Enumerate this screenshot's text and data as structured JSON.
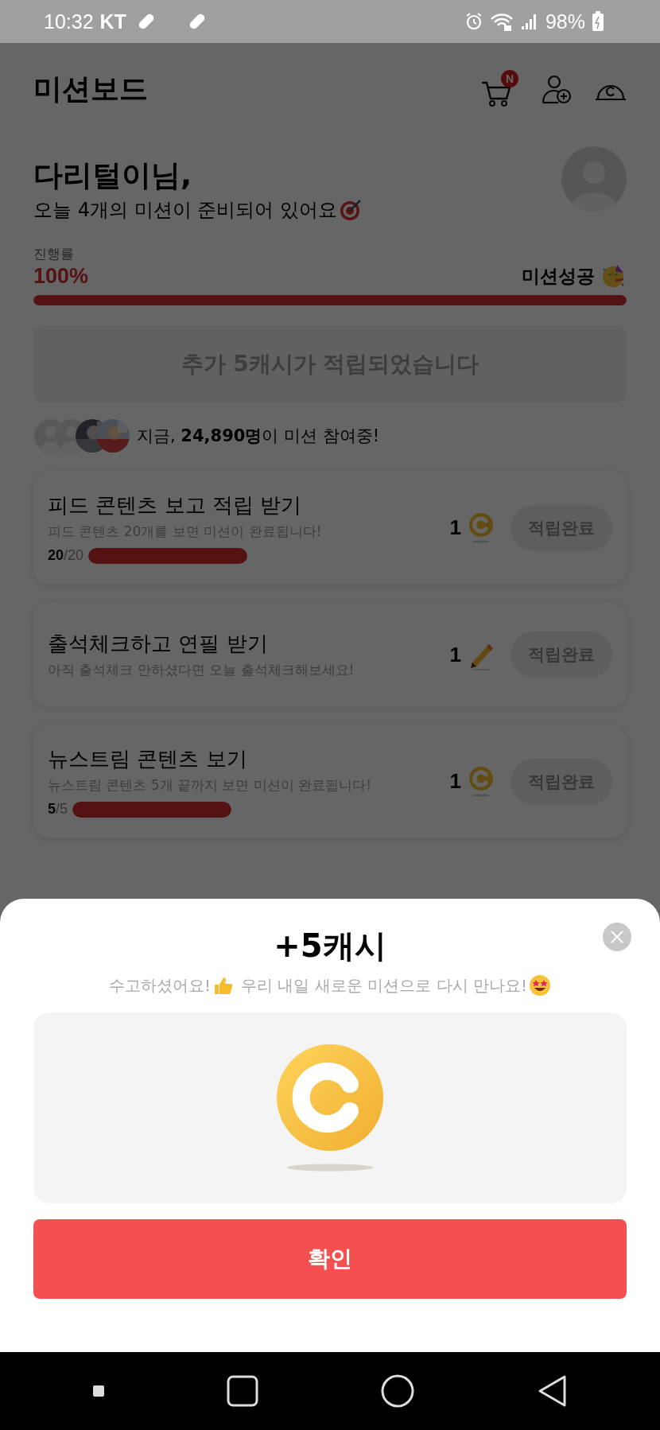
{
  "status_bar": {
    "time": "10:32",
    "carrier": "KT",
    "battery": "98%"
  },
  "header": {
    "title": "미션보드",
    "cart_badge": "N"
  },
  "greeting": {
    "name": "다리털이님,",
    "message": "오늘 4개의 미션이 준비되어 있어요"
  },
  "progress": {
    "label": "진행률",
    "percent": "100%",
    "level": 1,
    "status": "미션성공"
  },
  "bonus_banner": "추가 5캐시가 적립되었습니다",
  "participants": {
    "text": "지금, **24,890명**이 미션 참여중!",
    "avatars": [
      {
        "kind": "silhouette"
      },
      {
        "kind": "silhouette"
      },
      {
        "kind": "picture"
      },
      {
        "kind": "picture"
      }
    ]
  },
  "missions": [
    {
      "title": "피드 콘텐츠 보고 적립 받기",
      "description": "피드 콘텐츠 20개를 보면 미션이 완료됩니다!",
      "reward": "1",
      "kind": "coin",
      "button": "적립완료",
      "progress": {
        "count": "**20**/20",
        "level": 1
      }
    },
    {
      "title": "출석체크하고 연필 받기",
      "description": "아직 출석체크 안하셨다면 오늘 출석체크해보세요!",
      "reward": "1",
      "kind": "pencil",
      "button": "적립완료"
    },
    {
      "title": "뉴스트림 콘텐츠 보기",
      "description": "뉴스트림 콘텐츠 5개 끝까지 보면 미션이 완료됩니다!",
      "reward": "1",
      "kind": "coin",
      "button": "적립완료",
      "progress": {
        "count": "**5**/5",
        "level": 1
      }
    }
  ],
  "sheet": {
    "title": "+5캐시",
    "message_1": "수고하셨어요!",
    "message_2": "우리 내일 새로운 미션으로 다시 만나요!",
    "confirm": "확인"
  }
}
